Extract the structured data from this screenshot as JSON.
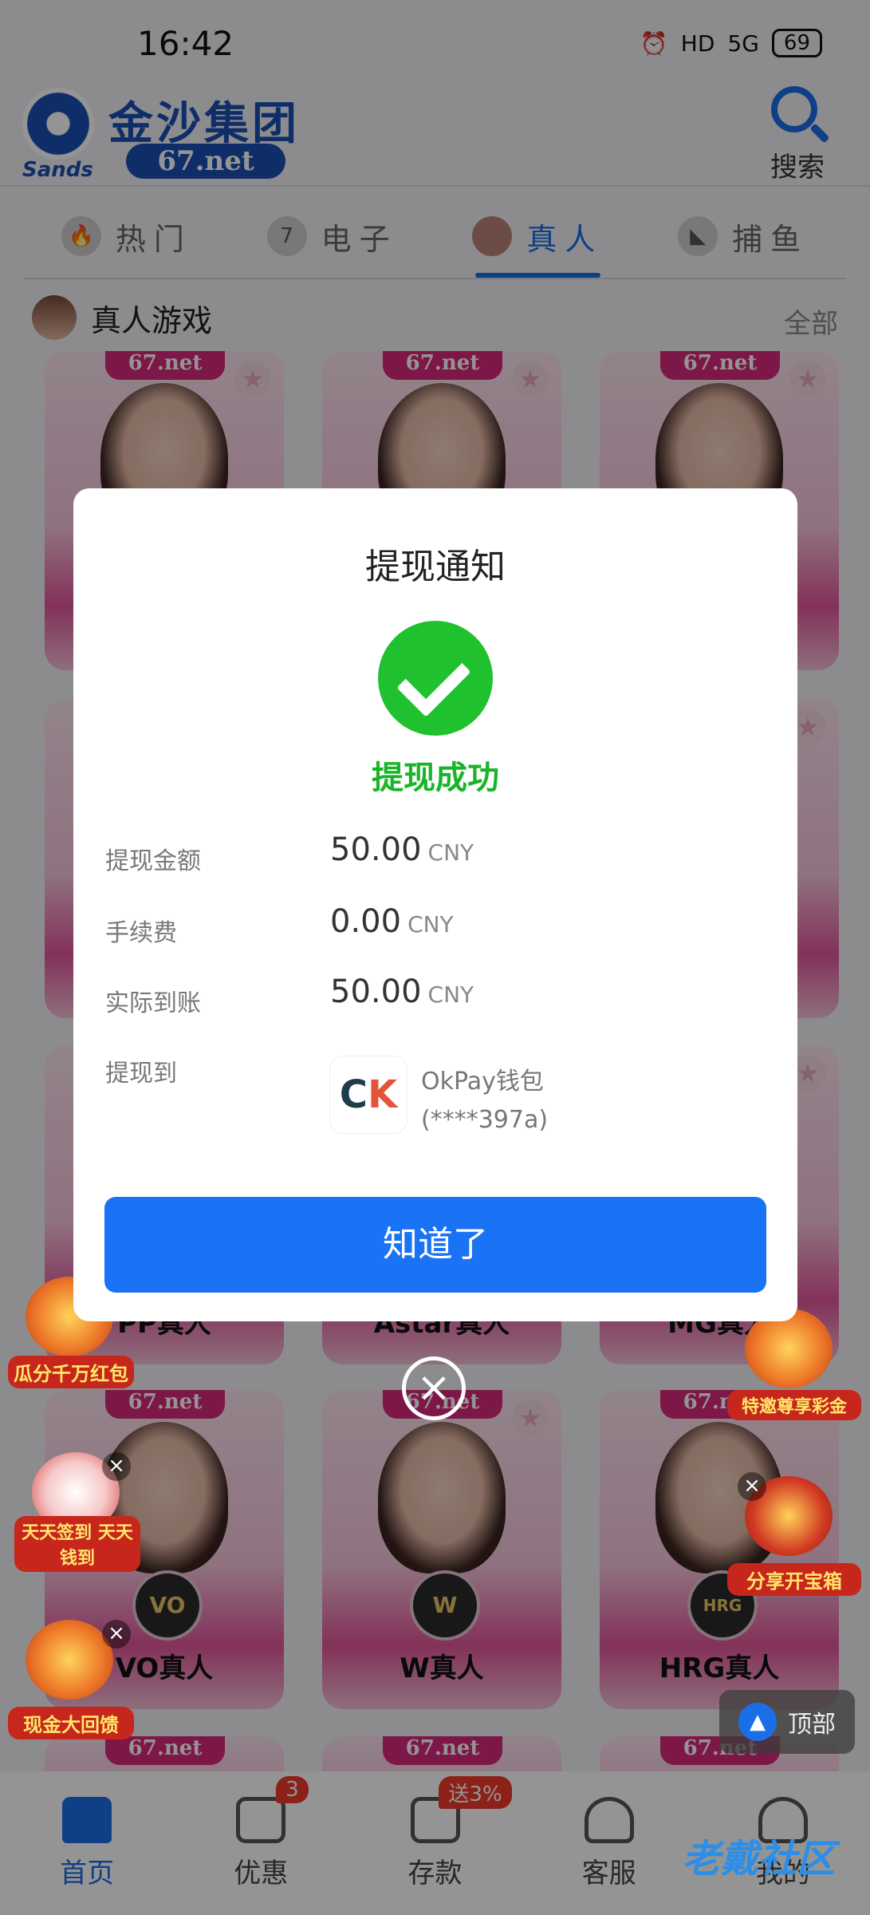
{
  "status_bar": {
    "time": "16:42",
    "hd": "HD",
    "net": "5G",
    "battery": "69"
  },
  "header": {
    "brand_name": "金沙集团",
    "brand_sub": "Sands",
    "brand_url": "67.net",
    "search_label": "搜索"
  },
  "tabs": [
    {
      "label": "热门",
      "icon": "fire-icon"
    },
    {
      "label": "电子",
      "icon": "slot-777-icon"
    },
    {
      "label": "真人",
      "icon": "live-dealer-icon",
      "active": true
    },
    {
      "label": "捕鱼",
      "icon": "shark-icon"
    }
  ],
  "section": {
    "title": "真人游戏",
    "all_label": "全部"
  },
  "cards": [
    {
      "tag": "67.net",
      "name": ""
    },
    {
      "tag": "67.net",
      "name": ""
    },
    {
      "tag": "67.net",
      "name": ""
    },
    {
      "tag": "67.net",
      "name": "PP真人"
    },
    {
      "tag": "67.net",
      "name": "Astar真人"
    },
    {
      "tag": "67.net",
      "name": "MG真人"
    },
    {
      "tag": "67.net",
      "name": "VO真人",
      "chip": "VO"
    },
    {
      "tag": "67.net",
      "name": "W真人",
      "chip": "W"
    },
    {
      "tag": "67.net",
      "name": "HRG真人",
      "chip": "HRG"
    }
  ],
  "promos": {
    "left1": "瓜分千万红包",
    "left2": "天天签到 天天钱到",
    "left3": "现金大回馈",
    "right1": "特邀尊享彩金",
    "right2": "分享开宝箱"
  },
  "top_button": "顶部",
  "bottom_nav": [
    {
      "label": "首页",
      "icon": "home-icon",
      "active": true
    },
    {
      "label": "优惠",
      "icon": "gift-icon",
      "badge": "3"
    },
    {
      "label": "存款",
      "icon": "wallet-icon",
      "badge": "送3%"
    },
    {
      "label": "客服",
      "icon": "headset-icon"
    },
    {
      "label": "我的",
      "icon": "user-icon"
    }
  ],
  "watermark": "老戴社区",
  "modal": {
    "title": "提现通知",
    "status": "提现成功",
    "rows": [
      {
        "label": "提现金额",
        "value": "50.00",
        "unit": "CNY"
      },
      {
        "label": "手续费",
        "value": "0.00",
        "unit": "CNY"
      },
      {
        "label": "实际到账",
        "value": "50.00",
        "unit": "CNY"
      }
    ],
    "dest_label": "提现到",
    "wallet_name": "OkPay钱包",
    "wallet_account": "(****397a)",
    "confirm_label": "知道了"
  },
  "colors": {
    "accent": "#1b6fe6",
    "success": "#1fc12f",
    "button": "#1a73f5",
    "card_pink": "#e2559b"
  }
}
